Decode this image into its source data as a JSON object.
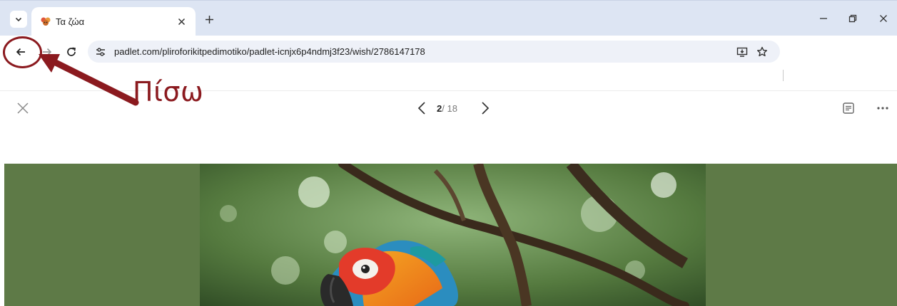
{
  "browser": {
    "tab": {
      "title": "Τα ζώα"
    },
    "address_bar": {
      "url": "padlet.com/pliroforikitpedimotiko/padlet-icnjx6p4ndmj3f23/wish/2786147178"
    }
  },
  "padlet": {
    "counter": {
      "current": "2",
      "total": "/ 18"
    }
  },
  "annotation": {
    "label": "Πίσω",
    "color": "#8b1a1f"
  },
  "colors": {
    "tabstrip": "#dde5f3",
    "omnibox": "#eef1f8",
    "image_background": "#5e7a47"
  },
  "icons": [
    "tab-search-icon",
    "favicon-icon",
    "close-icon",
    "new-tab-icon",
    "minimize-icon",
    "restore-icon",
    "back-arrow-icon",
    "forward-arrow-icon",
    "reload-icon",
    "site-settings-icon",
    "install-app-icon",
    "bookmark-star-icon",
    "chevron-left-icon",
    "chevron-right-icon",
    "reader-icon",
    "more-icon"
  ]
}
